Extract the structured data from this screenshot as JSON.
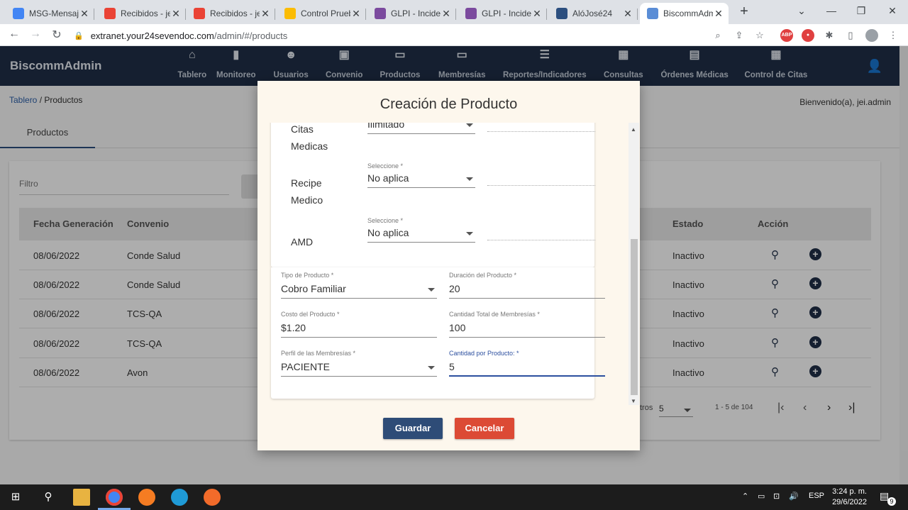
{
  "browser": {
    "tabs": [
      {
        "title": "MSG-Mensaj",
        "favicon": "docs-icon",
        "color": "#4285f4"
      },
      {
        "title": "Recibidos - je",
        "favicon": "gmail-icon",
        "color": "#ea4335"
      },
      {
        "title": "Recibidos - je",
        "favicon": "gmail-icon",
        "color": "#ea4335"
      },
      {
        "title": "Control Prueb",
        "favicon": "drive-icon",
        "color": "#fbbc04"
      },
      {
        "title": "GLPI - Incider",
        "favicon": "glpi-icon",
        "color": "#7b4a9e"
      },
      {
        "title": "GLPI - Incider",
        "favicon": "glpi-icon",
        "color": "#7b4a9e"
      },
      {
        "title": "AlóJosé24",
        "favicon": "alojose-icon",
        "color": "#2c4f7f"
      },
      {
        "title": "BiscommAdm",
        "favicon": "biscomm-icon",
        "color": "#5a8dd6"
      }
    ],
    "url_host": "extranet.your24sevendoc.com",
    "url_path": "/admin/#/products"
  },
  "app": {
    "brand": "BiscommAdmin",
    "nav": [
      {
        "label": "Tablero",
        "icon": "home-icon",
        "glyph": "⌂"
      },
      {
        "label": "Monitoreo",
        "icon": "bar-chart-icon",
        "glyph": "▮"
      },
      {
        "label": "Usuarios",
        "icon": "users-icon",
        "glyph": "☻"
      },
      {
        "label": "Convenio",
        "icon": "store-icon",
        "glyph": "▣"
      },
      {
        "label": "Productos",
        "icon": "card-icon",
        "glyph": "▭"
      },
      {
        "label": "Membresías",
        "icon": "card-icon",
        "glyph": "▭"
      },
      {
        "label": "Reportes/Indicadores",
        "icon": "list-icon",
        "glyph": "☰"
      },
      {
        "label": "Consultas",
        "icon": "calendar-icon",
        "glyph": "▦"
      },
      {
        "label": "Órdenes Médicas",
        "icon": "clipboard-icon",
        "glyph": "▤"
      },
      {
        "label": "Control de Citas",
        "icon": "calendar-icon",
        "glyph": "▦"
      }
    ],
    "breadcrumb_link": "Tablero",
    "breadcrumb_current": " / Productos",
    "welcome": "Bienvenido(a), jei.admin",
    "tab_label": "Productos",
    "filter_label": "Filtro"
  },
  "table": {
    "headers": {
      "fecha": "Fecha Generación",
      "convenio": "Convenio",
      "estado": "Estado",
      "accion": "Acción"
    },
    "rows": [
      {
        "fecha": "08/06/2022",
        "convenio": "Conde Salud",
        "estado": "Inactivo"
      },
      {
        "fecha": "08/06/2022",
        "convenio": "Conde Salud",
        "estado": "Inactivo"
      },
      {
        "fecha": "08/06/2022",
        "convenio": "TCS-QA",
        "estado": "Inactivo"
      },
      {
        "fecha": "08/06/2022",
        "convenio": "TCS-QA",
        "estado": "Inactivo"
      },
      {
        "fecha": "08/06/2022",
        "convenio": "Avon",
        "estado": "Inactivo"
      }
    ],
    "pager_prefix": "tros",
    "pager_size": "5",
    "pager_range": "1 - 5 de 104"
  },
  "modal": {
    "title": "Creación de Producto",
    "services": [
      {
        "name_line1": "Citas",
        "name_line2": "Medicas",
        "select_label": "",
        "value": "Ilimitado"
      },
      {
        "name_line1": "Recipe",
        "name_line2": "Medico",
        "select_label": "Seleccione *",
        "value": "No aplica"
      },
      {
        "name_line1": "AMD",
        "name_line2": "",
        "select_label": "Seleccione *",
        "value": "No aplica"
      }
    ],
    "fields": {
      "tipo_label": "Tipo de Producto *",
      "tipo_value": "Cobro Familiar",
      "duracion_label": "Duración del Producto *",
      "duracion_value": "20",
      "costo_label": "Costo del Producto *",
      "costo_value": "$1.20",
      "cantidad_total_label": "Cantidad Total de Membresías *",
      "cantidad_total_value": "100",
      "perfil_label": "Perfil de las Membresías *",
      "perfil_value": "PACIENTE",
      "cantidad_prod_label": "Cantidad por Producto: *",
      "cantidad_prod_value": "5"
    },
    "save_label": "Guardar",
    "cancel_label": "Cancelar"
  },
  "taskbar": {
    "lang": "ESP",
    "time": "3:24 p. m.",
    "date": "29/6/2022",
    "notif_count": "9"
  }
}
